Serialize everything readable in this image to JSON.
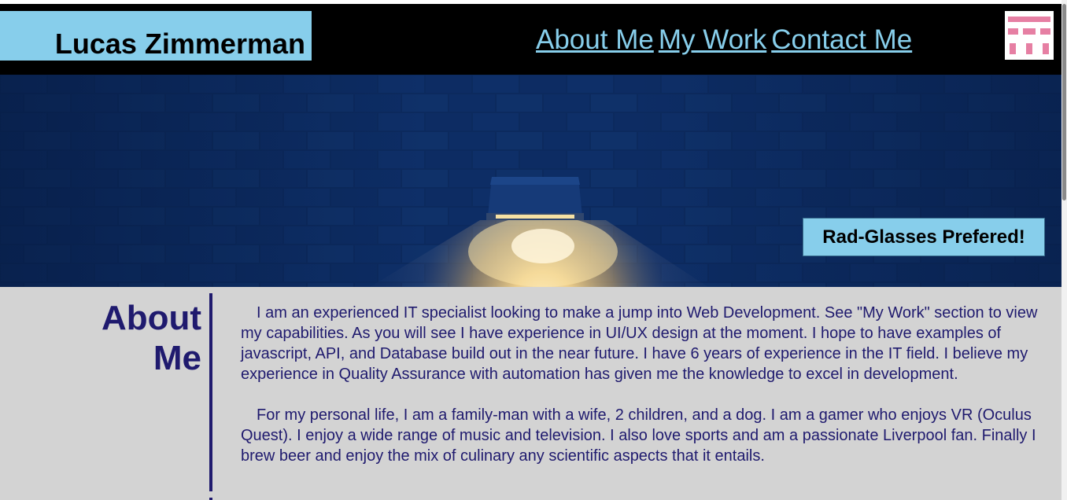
{
  "header": {
    "name": "Lucas Zimmerman",
    "nav": [
      {
        "label": "About Me"
      },
      {
        "label": "My Work"
      },
      {
        "label": "Contact Me"
      }
    ]
  },
  "hero": {
    "tagline": "Rad-Glasses Prefered!"
  },
  "about": {
    "heading_line1": "About",
    "heading_line2": "Me",
    "paragraphs": [
      "I am an experienced IT specialist looking to make a jump into Web Development. See \"My Work\" section to view my capabilities. As you will see I have experience in UI/UX design at the moment. I hope to have examples of javascript, API, and Database build out in the near future. I have 6 years of experience in the IT field. I believe my experience in Quality Assurance with automation has given me the knowledge to excel in development.",
      "For my personal life, I am a family-man with a wife, 2 children, and a dog. I am a gamer who enjoys VR (Oculus Quest). I enjoy a wide range of music and television. I also love sports and am a passionate Liverpool fan. Finally I brew beer and enjoy the mix of culinary any scientific aspects that it entails."
    ]
  },
  "colors": {
    "accent": "#87ceeb",
    "header_bg": "#000000",
    "section_bg": "#d3d3d3",
    "text_dark": "#1f1a6e",
    "logo_pink": "#e67fa3"
  },
  "icons": {
    "logo": "pink-pixel-logo-icon"
  }
}
